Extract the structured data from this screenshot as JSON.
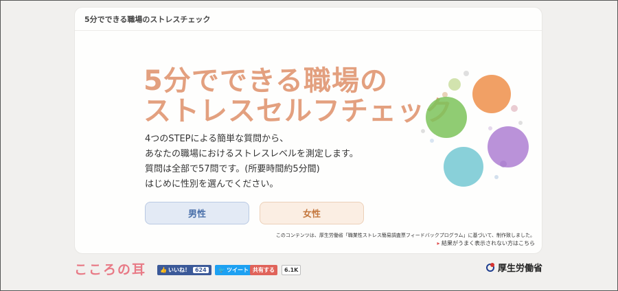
{
  "card": {
    "header_title": "5分でできる職場のストレスチェック"
  },
  "hero": {
    "line1": "5分でできる職場の",
    "line2": "ストレスセルフチェック"
  },
  "description": [
    "4つのSTEPによる簡単な質問から、",
    "あなたの職場におけるストレスレベルを測定します。",
    "質問は全部で57問です。(所要時間約5分間)",
    "はじめに性別を選んでください。"
  ],
  "buttons": {
    "male": "男性",
    "female": "女性"
  },
  "credit": "このコンテンツは、厚生労働省「職業性ストレス簡易調査票フィードバックプログラム」に基づいて、制作致しました。",
  "result_link": {
    "arrow": "▸",
    "text": "結果がうまく表示されない方はこちら"
  },
  "footer": {
    "logo": "こころの耳",
    "fb_label": "いいね！",
    "fb_count": "624",
    "tweet_label": "ツイート",
    "share_label": "共有する",
    "share_count": "6.1K",
    "ministry": "厚生労働省"
  },
  "colors": {
    "green": "#7cc35a",
    "orange": "#ee8f4a",
    "purple": "#a977cf",
    "teal": "#6cc4cf"
  }
}
